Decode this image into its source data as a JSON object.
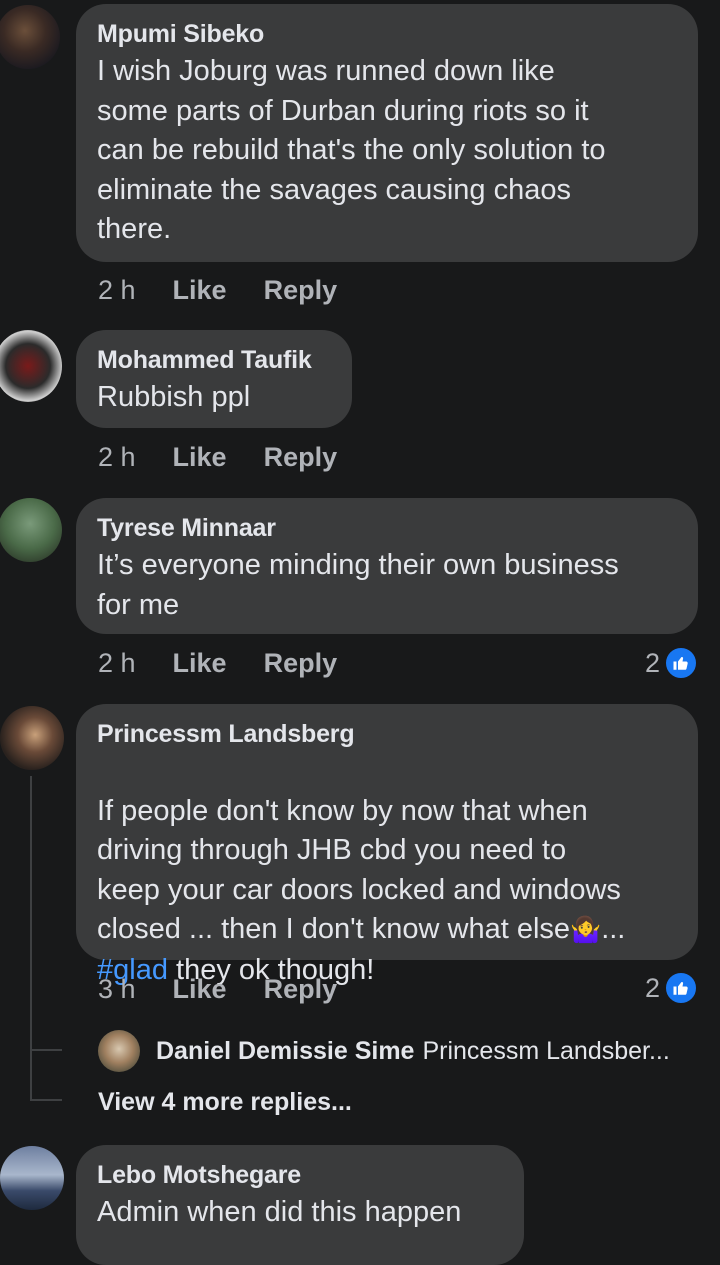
{
  "comments": [
    {
      "author": "Mpumi Sibeko",
      "text": "I wish Joburg was runned down like\nsome parts of Durban during riots so it\ncan be rebuild that's the only solution to\neliminate  the savages causing chaos\nthere.",
      "time": "2 h",
      "like": "Like",
      "reply": "Reply"
    },
    {
      "author": "Mohammed Taufik",
      "text": "Rubbish ppl",
      "time": "2 h",
      "like": "Like",
      "reply": "Reply"
    },
    {
      "author": "Tyrese Minnaar",
      "text": "It’s everyone minding their own business\nfor me",
      "time": "2 h",
      "like": "Like",
      "reply": "Reply",
      "reaction_count": "2"
    },
    {
      "author": "Princessm Landsberg",
      "text_main": "If people don't know by now that when\ndriving through JHB cbd you need to\nkeep your car doors locked and windows\nclosed ... then I don't know what else",
      "emoji": "🤷‍♀️",
      "text_ellipsis": "...",
      "hashtag": "#glad",
      "text_tail": " they ok though!",
      "time": "3 h",
      "like": "Like",
      "reply": "Reply",
      "reaction_count": "2",
      "reply_preview": {
        "author": "Daniel Demissie Sime",
        "snippet": "Princessm Landsber..."
      },
      "view_more": "View 4 more replies..."
    },
    {
      "author": "Lebo Motshegare",
      "text": "Admin when did this happen"
    }
  ],
  "icons": {
    "like_badge": "thumbs-up-icon"
  },
  "colors": {
    "background": "#18191a",
    "bubble": "#3a3b3c",
    "link": "#4599ff",
    "like_blue": "#1877f2"
  }
}
